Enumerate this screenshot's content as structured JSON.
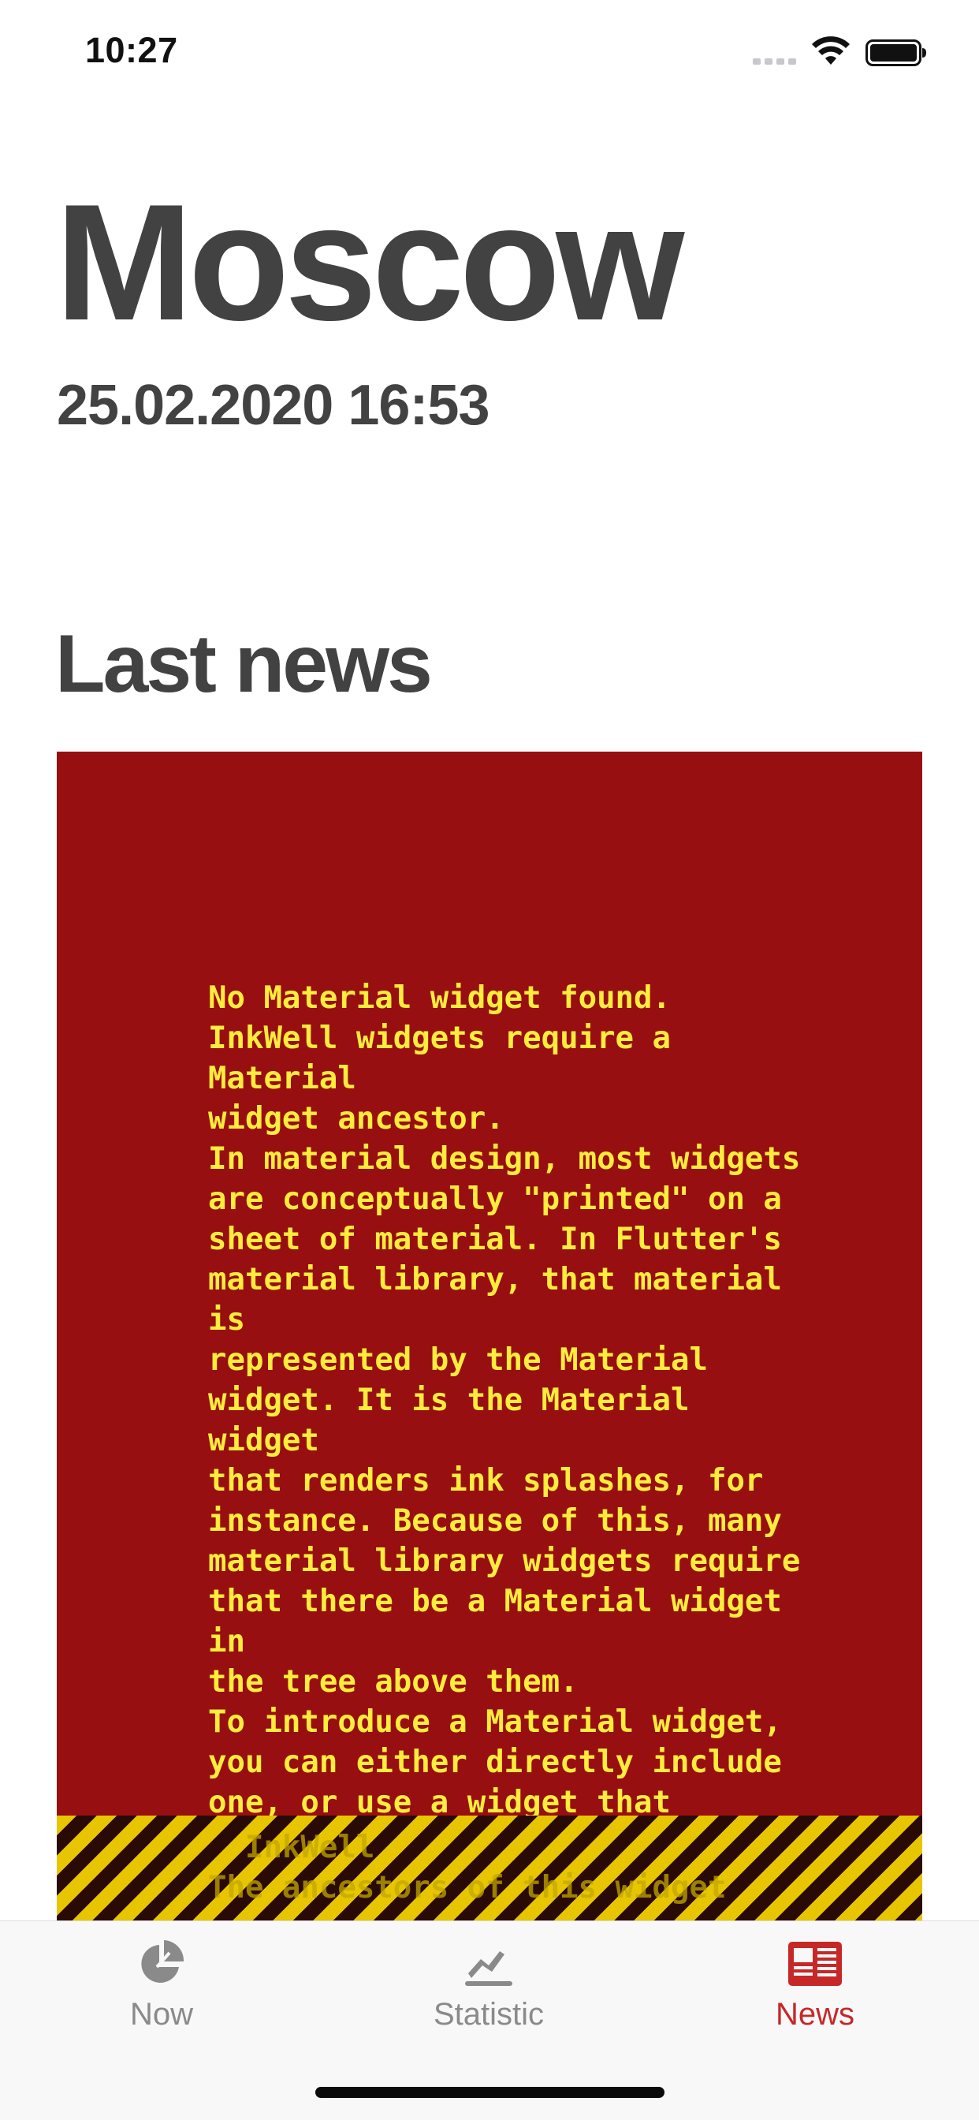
{
  "status_bar": {
    "time": "10:27"
  },
  "header": {
    "city": "Moscow",
    "datetime": "25.02.2020 16:53"
  },
  "news": {
    "section_title": "Last news",
    "error_message": "No Material widget found.\nInkWell widgets require a Material\nwidget ancestor.\nIn material design, most widgets\nare conceptually \"printed\" on a\nsheet of material. In Flutter's\nmaterial library, that material is\nrepresented by the Material\nwidget. It is the Material widget\nthat renders ink splashes, for\ninstance. Because of this, many\nmaterial library widgets require\nthat there be a Material widget in\nthe tree above them.\nTo introduce a Material widget,\nyou can either directly include\none, or use a widget that contains\nMaterial itself, such as a Card,\nDialog, Drawer, or Scaffold.\nThe specific widget that could not\nfind a Material ancestor was:",
    "error_overflow_text": "  InkWell\nThe ancestors of this widget were:\n  Column",
    "colors": {
      "error_background": "#970f11",
      "error_text": "#ffec3c"
    }
  },
  "tab_bar": {
    "tabs": [
      {
        "label": "Now",
        "icon": "pie-chart-icon",
        "active": false
      },
      {
        "label": "Statistic",
        "icon": "trend-line-icon",
        "active": false
      },
      {
        "label": "News",
        "icon": "newspaper-icon",
        "active": true
      }
    ],
    "colors": {
      "active": "#c62828",
      "inactive": "#8a8a8a"
    }
  }
}
